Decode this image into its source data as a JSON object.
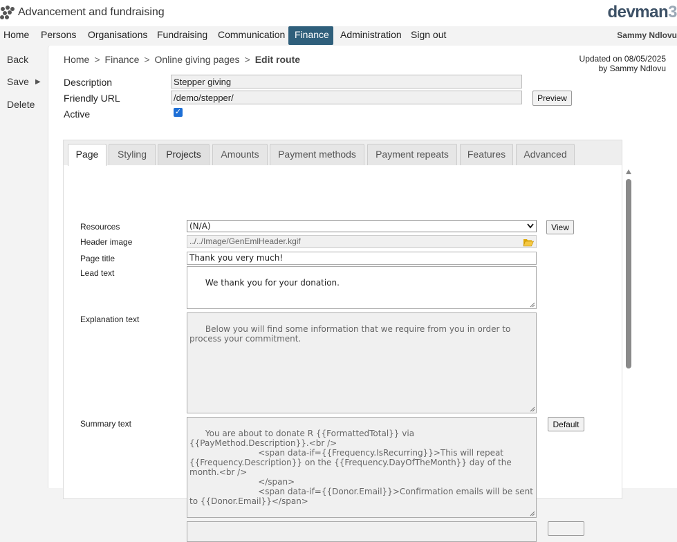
{
  "app": {
    "title": "Advancement and fundraising",
    "brand": "devman",
    "brand_tail": "3"
  },
  "nav": {
    "items": [
      "Home",
      "Persons",
      "Organisations",
      "Fundraising",
      "Communication",
      "Finance",
      "Administration",
      "Sign out"
    ],
    "active": "Finance",
    "user": "Sammy Ndlovu"
  },
  "actions": {
    "back": "Back",
    "save": "Save",
    "delete": "Delete"
  },
  "breadcrumb": {
    "items": [
      "Home",
      "Finance",
      "Online giving pages"
    ],
    "current": "Edit route",
    "separator": ">"
  },
  "updated": {
    "line1": "Updated on 08/05/2025",
    "line2": "by Sammy Ndlovu"
  },
  "form": {
    "description_label": "Description",
    "description_value": "Stepper giving",
    "friendly_url_label": "Friendly URL",
    "friendly_url_value": "/demo/stepper/",
    "preview_label": "Preview",
    "active_label": "Active",
    "active_checked": true
  },
  "tabs": {
    "items": [
      "Page",
      "Styling",
      "Projects",
      "Amounts",
      "Payment methods",
      "Payment repeats",
      "Features",
      "Advanced"
    ],
    "selected": "Page"
  },
  "page_tab": {
    "resources_label": "Resources",
    "resources_value": "(N/A)",
    "view_label": "View",
    "header_image_label": "Header image",
    "header_image_value": "../../Image/GenEmlHeader.kgif",
    "page_title_label": "Page title",
    "page_title_value": "Thank you very much!",
    "lead_text_label": "Lead text",
    "lead_text_value": "We thank you for your donation.",
    "explanation_text_label": "Explanation text",
    "explanation_text_placeholder": "Below you will find some information that we require from you in order to process your commitment.",
    "summary_text_label": "Summary text",
    "summary_text_placeholder": "You are about to donate R {{FormattedTotal}} via {{PayMethod.Description}}.<br />\n                          <span data-if={{Frequency.IsRecurring}}>This will repeat {{Frequency.Description}} on the {{Frequency.DayOfTheMonth}} day of the month.<br />\n                          </span>\n                          <span data-if={{Donor.Email}}>Confirmation emails will be sent to {{Donor.Email}}</span>",
    "default_label": "Default"
  }
}
